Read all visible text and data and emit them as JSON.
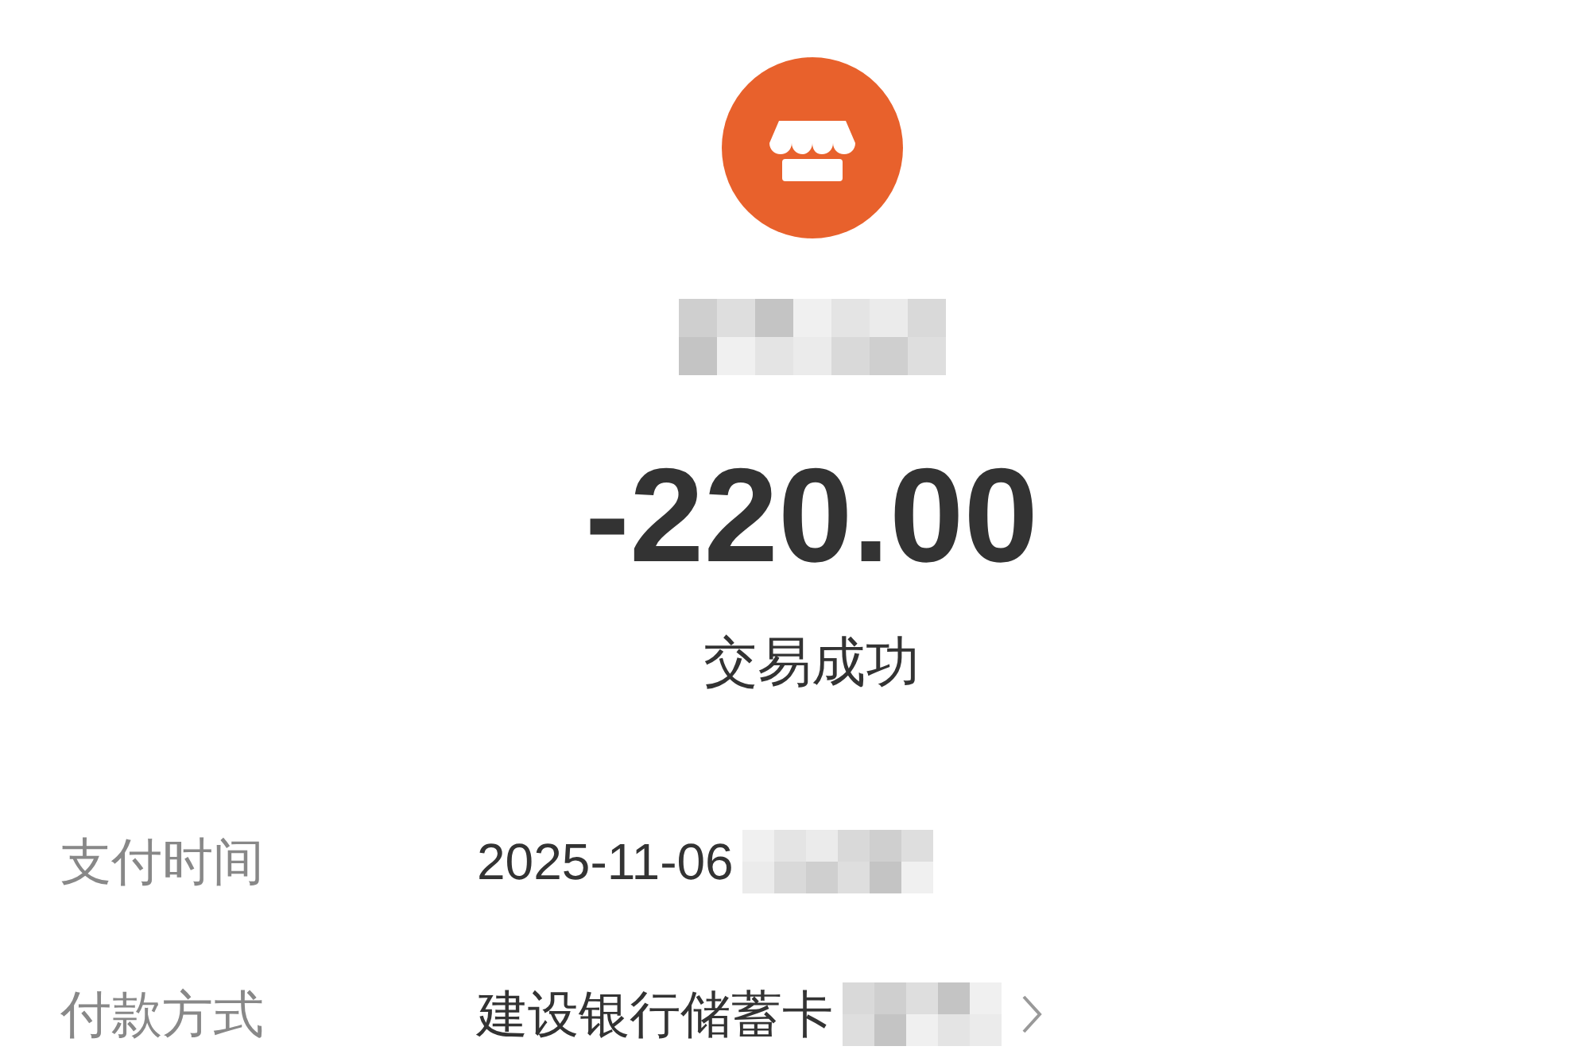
{
  "amount": "-220.00",
  "status": "交易成功",
  "details": [
    {
      "label": "支付时间",
      "value": "2025-11-06",
      "has_arrow": false
    },
    {
      "label": "付款方式",
      "value": "建设银行储蓄卡",
      "has_arrow": true
    }
  ]
}
